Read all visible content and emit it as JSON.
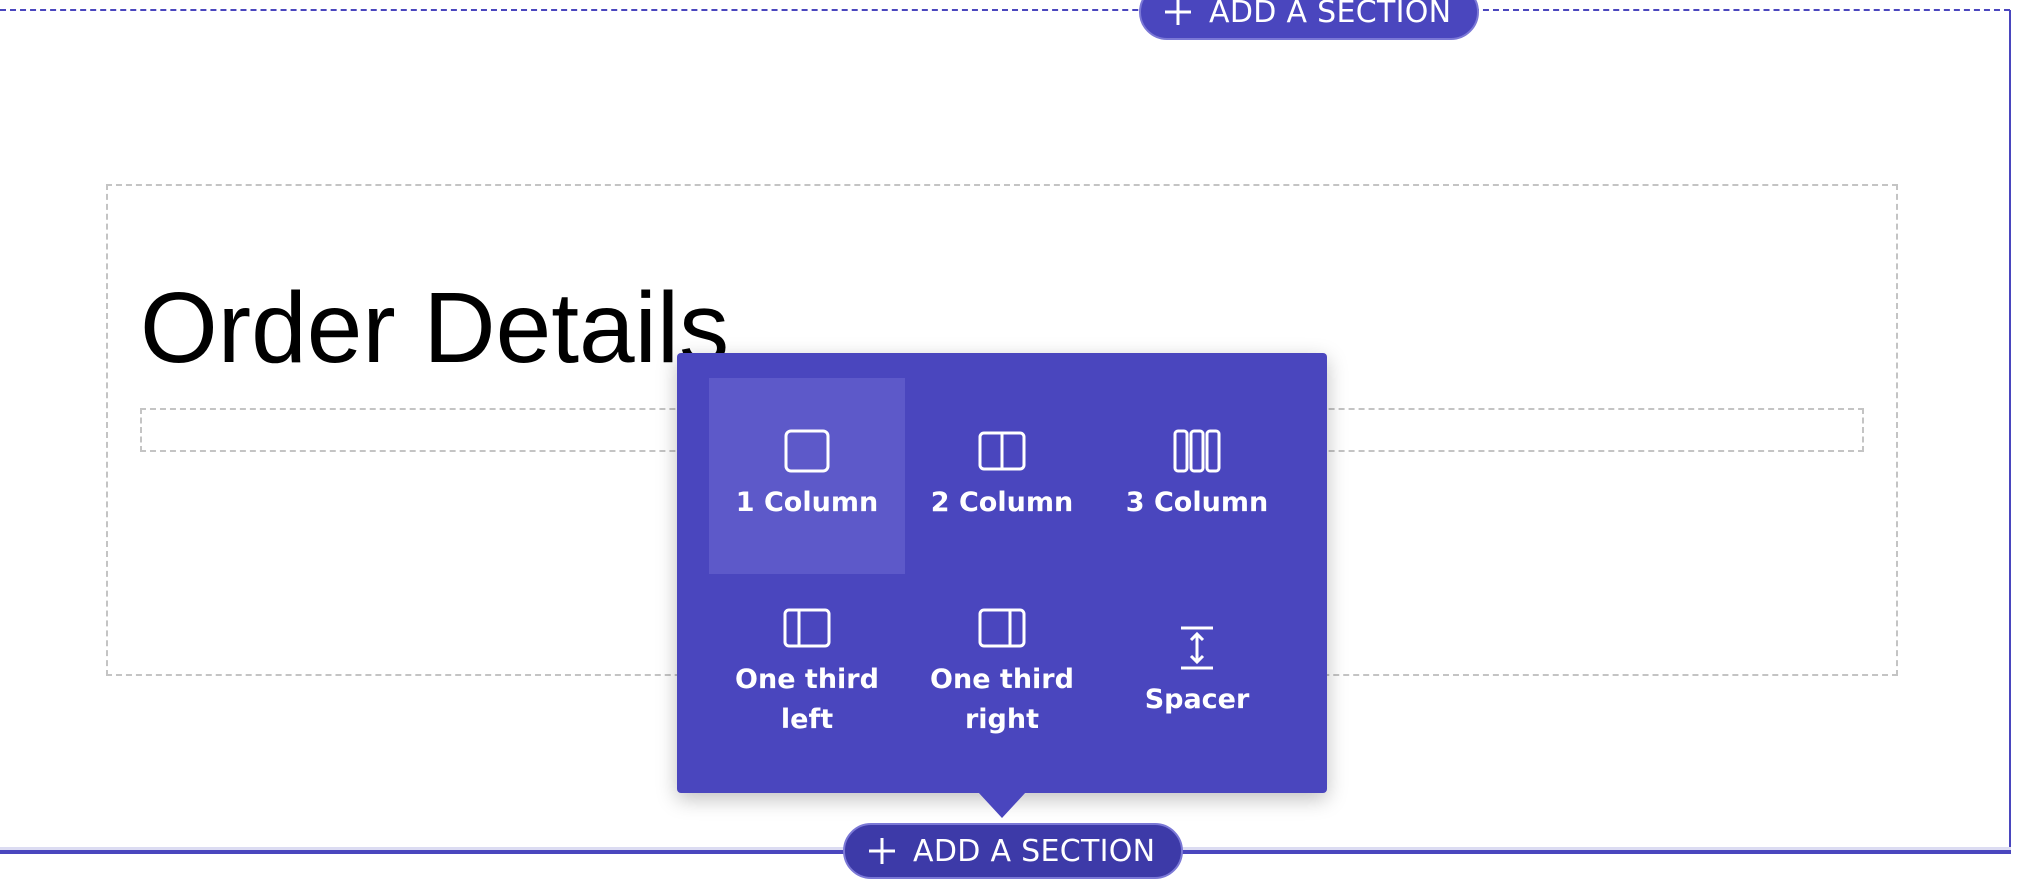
{
  "sections": {
    "top_add_button": {
      "label": "ADD A SECTION",
      "icon": "plus-icon"
    },
    "bottom_add_button": {
      "label": "ADD A SECTION",
      "icon": "plus-icon"
    }
  },
  "content": {
    "title": "Order Details"
  },
  "layout_menu": {
    "options": [
      {
        "label": "1 Column",
        "icon": "one-column-icon",
        "selected": true
      },
      {
        "label": "2 Column",
        "icon": "two-column-icon",
        "selected": false
      },
      {
        "label": "3 Column",
        "icon": "three-column-icon",
        "selected": false
      },
      {
        "label": "One third left",
        "icon": "one-third-left-icon",
        "selected": false
      },
      {
        "label": "One third right",
        "icon": "one-third-right-icon",
        "selected": false
      },
      {
        "label": "Spacer",
        "icon": "spacer-icon",
        "selected": false
      }
    ]
  },
  "colors": {
    "accent": "#4a46be",
    "accent_hover": "#5d59c9",
    "dashed_border": "#c4c4c4"
  }
}
